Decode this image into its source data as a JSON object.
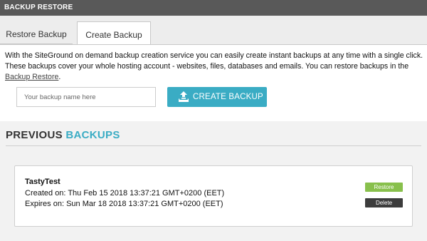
{
  "window": {
    "title": "BACKUP RESTORE"
  },
  "tabs": [
    {
      "label": "Restore Backup",
      "active": false
    },
    {
      "label": "Create Backup",
      "active": true
    }
  ],
  "create_panel": {
    "description_before_link": "With the SiteGround on demand backup creation service you can easily create instant backups at any time with a single click. These backups cover your whole hosting account - websites, files, databases and emails. You can restore backups in the ",
    "link_text": "Backup Restore",
    "description_after_link": ".",
    "name_input": {
      "placeholder": "Your backup name here",
      "value": ""
    },
    "create_button": {
      "label": "CREATE BACKUP",
      "icon": "upload-icon"
    }
  },
  "previous_backups": {
    "title_prefix": "PREVIOUS",
    "title_accent": "BACKUPS",
    "items": [
      {
        "name": "TastyTest",
        "created": "Created on: Thu Feb 15 2018 13:37:21 GMT+0200 (EET)",
        "expires": "Expires on: Sun Mar 18 2018 13:37:21 GMT+0200 (EET)",
        "restore_label": "Restore",
        "delete_label": "Delete"
      }
    ]
  },
  "colors": {
    "titlebar": "#595959",
    "accent": "#3aacc4",
    "restore_button": "#88c04c",
    "delete_button": "#3c3c3c"
  }
}
